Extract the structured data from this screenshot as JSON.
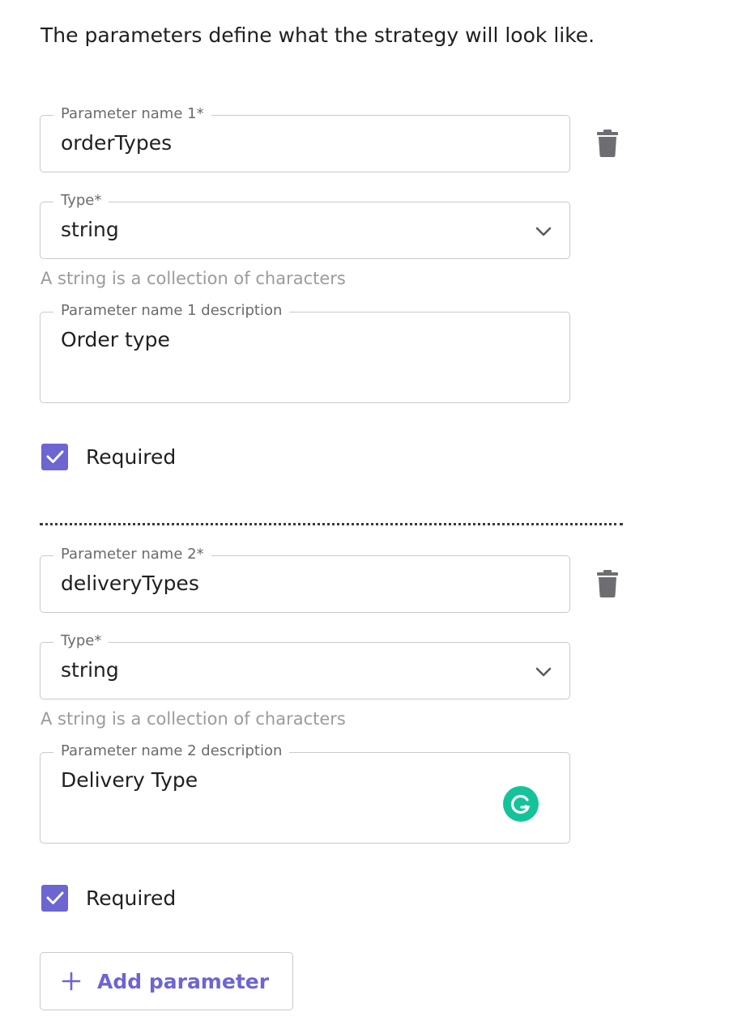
{
  "intro_text": "The parameters define what the strategy will look like.",
  "parameters": [
    {
      "name_label": "Parameter name 1*",
      "name_value": "orderTypes",
      "type_label": "Type*",
      "type_value": "string",
      "type_helper": "A string is a collection of characters",
      "description_label": "Parameter name 1 description",
      "description_value": "Order type",
      "required_label": "Required",
      "required_checked": true
    },
    {
      "name_label": "Parameter name 2*",
      "name_value": "deliveryTypes",
      "type_label": "Type*",
      "type_value": "string",
      "type_helper": "A string is a collection of characters",
      "description_label": "Parameter name 2 description",
      "description_value": "Delivery Type",
      "required_label": "Required",
      "required_checked": true
    }
  ],
  "add_button_label": "Add parameter",
  "colors": {
    "accent": "#6c65d2",
    "border": "#c9c9cc",
    "helper_text": "#9b9b9f",
    "label_text": "#6b6b6f",
    "grammarly": "#15c39a"
  },
  "icons": {
    "delete": "trash-icon",
    "select": "chevron-down-icon",
    "check": "check-icon",
    "add": "plus-icon",
    "grammarly": "grammarly-icon"
  }
}
